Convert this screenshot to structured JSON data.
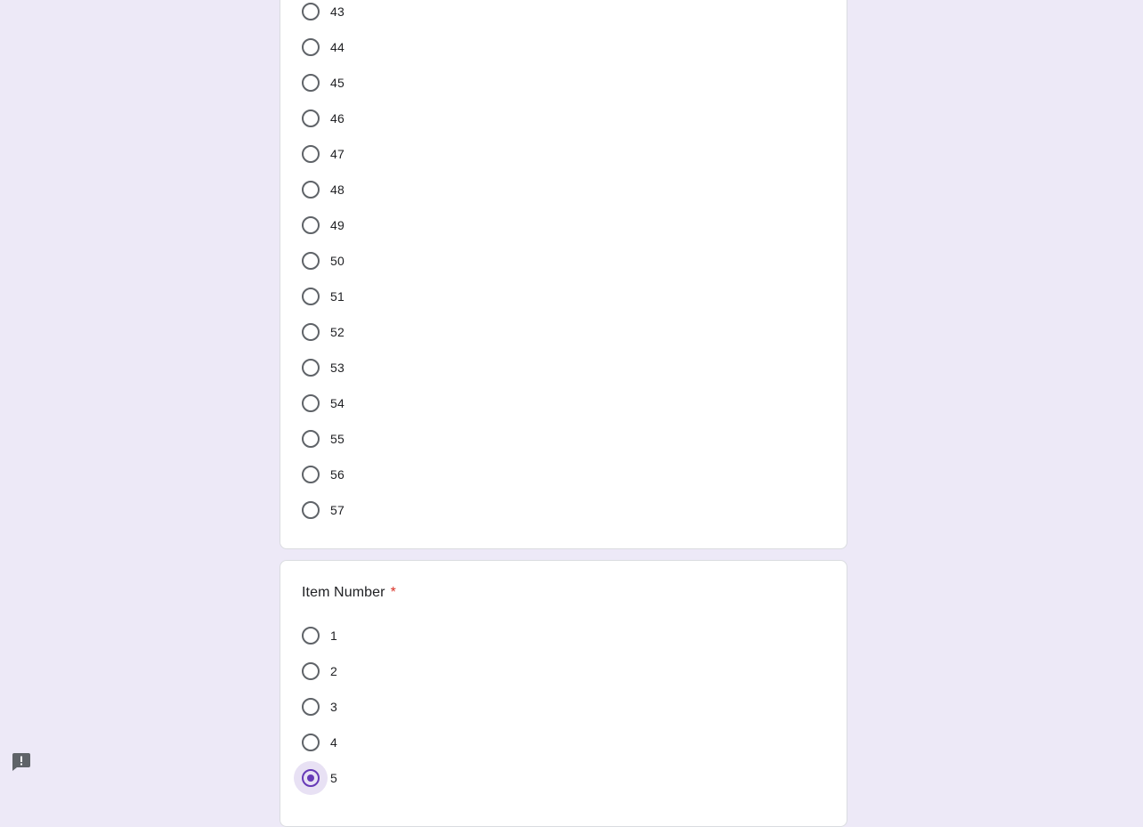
{
  "question1": {
    "options": [
      "43",
      "44",
      "45",
      "46",
      "47",
      "48",
      "49",
      "50",
      "51",
      "52",
      "53",
      "54",
      "55",
      "56",
      "57"
    ]
  },
  "question2": {
    "title": "Item Number",
    "required_mark": "*",
    "options": [
      "1",
      "2",
      "3",
      "4",
      "5"
    ],
    "selected": "5"
  },
  "colors": {
    "background": "#ede9f7",
    "accent": "#673ab7",
    "required": "#d93025",
    "radio_border": "#5f6368"
  },
  "icons": {
    "report": "report-problem-icon"
  }
}
